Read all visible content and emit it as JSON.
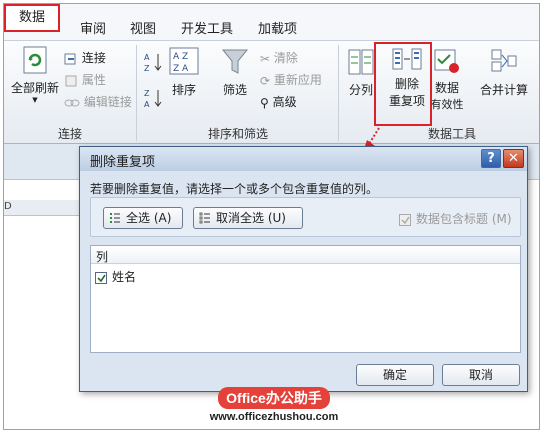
{
  "ribbon_tabs": {
    "data": "数据",
    "review": "审阅",
    "view": "视图",
    "developer": "开发工具",
    "addins": "加载项"
  },
  "connections": {
    "refresh_all": "全部刷新",
    "connections": "连接",
    "properties": "属性",
    "edit_links": "编辑链接",
    "group_label": "连接"
  },
  "sort_filter": {
    "sort": "排序",
    "filter": "筛选",
    "clear": "清除",
    "reapply": "重新应用",
    "advanced": "高级",
    "group_label": "排序和筛选"
  },
  "data_tools": {
    "text_to_columns": "分列",
    "remove_duplicates_line1": "删除",
    "remove_duplicates_line2": "重复项",
    "data_validation_line1": "数据",
    "data_validation_line2": "有效性",
    "consolidate": "合并计算",
    "group_label": "数据工具"
  },
  "sheet": {
    "col_d": "D"
  },
  "dialog": {
    "title": "删除重复项",
    "help": "?",
    "close": "✕",
    "instruction": "若要删除重复值，请选择一个或多个包含重复值的列。",
    "select_all": "全选 (A)",
    "unselect_all": "取消全选 (U)",
    "has_headers": "数据包含标题 (M)",
    "column_header": "列",
    "columns": [
      {
        "label": "姓名",
        "checked": true
      }
    ],
    "ok": "确定",
    "cancel": "取消"
  },
  "watermark": {
    "brand": "Office办公助手",
    "url": "www.officezhushou.com"
  },
  "colors": {
    "highlight": "#d9232a",
    "dialog_bg": "#dbe5f1"
  }
}
